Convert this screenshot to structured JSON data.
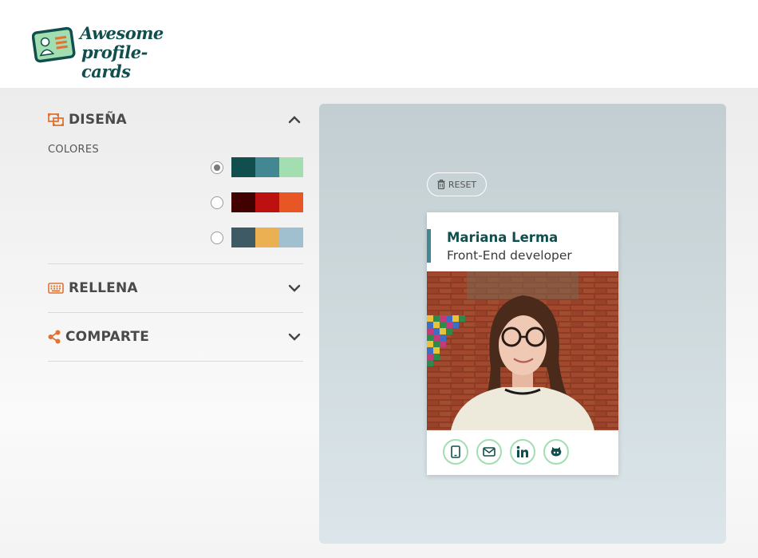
{
  "header": {
    "logo_icon": "id-card-icon",
    "logo_line1": "Awesome",
    "logo_line2": "profile-cards"
  },
  "sections": {
    "design": {
      "icon": "object-group-icon",
      "title": "DISEÑA",
      "colors_label": "COLORES",
      "palettes": [
        {
          "selected": true,
          "colors": [
            "#114e4e",
            "#438792",
            "#a2deaf"
          ]
        },
        {
          "selected": false,
          "colors": [
            "#420101",
            "#bd1010",
            "#e95626"
          ]
        },
        {
          "selected": false,
          "colors": [
            "#3e5b65",
            "#eab052",
            "#a0c0cf"
          ]
        }
      ]
    },
    "fill": {
      "icon": "keyboard-icon",
      "title": "RELLENA"
    },
    "share": {
      "icon": "share-icon",
      "title": "COMPARTE"
    }
  },
  "preview": {
    "reset_label": "RESET",
    "card": {
      "name": "Mariana Lerma",
      "job": "Front-End developer",
      "social": [
        "mobile-icon",
        "envelope-icon",
        "linkedin-icon",
        "github-icon"
      ]
    }
  },
  "colors": {
    "accent": "#e17334",
    "primary": "#114e4e",
    "secondary": "#438792",
    "tertiary": "#a2deaf"
  }
}
